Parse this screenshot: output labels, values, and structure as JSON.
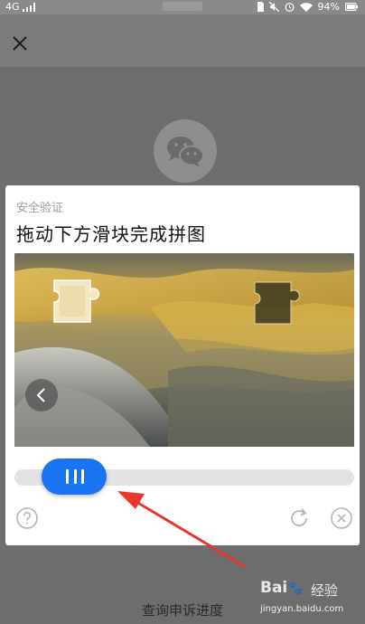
{
  "status_bar": {
    "network": "4G",
    "battery": "94%"
  },
  "dialog": {
    "subtitle": "安全验证",
    "title": "拖动下方滑块完成拼图"
  },
  "background": {
    "link_text": "查询申诉进度"
  },
  "slider": {
    "progress": 0.12
  },
  "watermark": {
    "brand": "Bai",
    "brand_suffix": "经验",
    "url": "jingyan.baidu.com"
  },
  "icons": {
    "close": "close-icon",
    "prev": "chevron-left-icon",
    "help": "help-icon",
    "refresh": "refresh-icon",
    "dialog_close": "close-circle-icon",
    "wechat": "wechat-logo-icon"
  },
  "colors": {
    "accent": "#1a73f0",
    "arrow": "#e8362a"
  }
}
